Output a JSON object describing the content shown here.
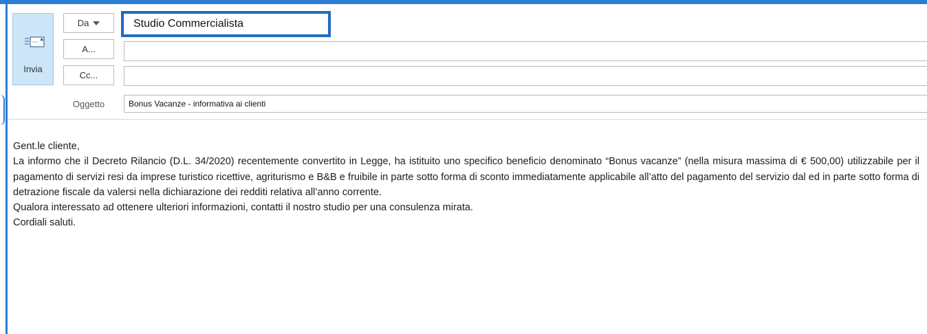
{
  "compose": {
    "send_label": "Invia",
    "from_button": "Da",
    "to_button": "A...",
    "cc_button": "Cc...",
    "from_value": "Studio Commercialista",
    "to_value": "",
    "cc_value": "",
    "subject_label": "Oggetto",
    "subject_value": "Bonus Vacanze - informativa ai clienti"
  },
  "body": {
    "greeting": "Gent.le cliente,",
    "paragraph": "La informo che il Decreto Rilancio (D.L. 34/2020) recentemente convertito in Legge, ha istituito uno specifico beneficio denominato “Bonus vacanze” (nella misura massima di € 500,00) utilizzabile per il pagamento di servizi resi da imprese turistico ricettive, agriturismo e B&B e fruibile in parte sotto forma di sconto immediatamente applicabile all’atto del pagamento del servizio dal ed in parte sotto forma di detrazione fiscale da valersi nella dichiarazione dei redditi relativa all’anno corrente.",
    "followup": "Qualora interessato ad ottenere ulteriori informazioni, contatti il nostro studio per una consulenza mirata.",
    "closing": "Cordiali saluti."
  },
  "colors": {
    "accent": "#2b7cd3",
    "send_button_bg": "#cde6f7",
    "from_highlight_border": "#1f6cbf"
  },
  "icons": {
    "send": "envelope-send-icon",
    "from_dropdown": "caret-down-icon"
  }
}
